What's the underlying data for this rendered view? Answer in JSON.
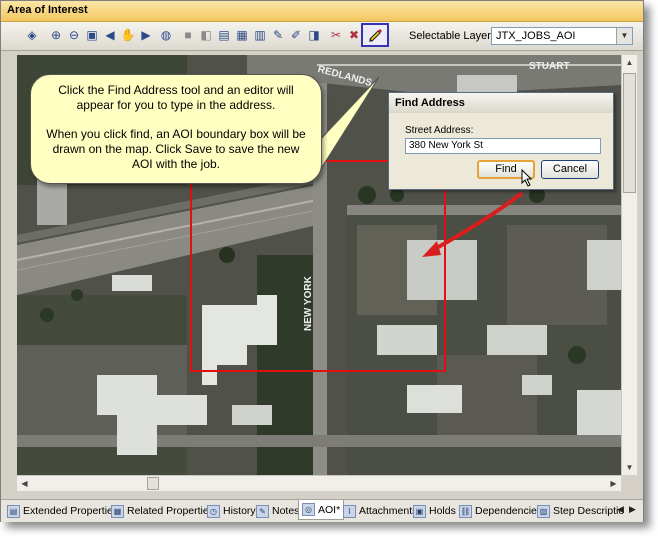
{
  "window": {
    "title": "Area of Interest"
  },
  "toolbar": {
    "icons": [
      "layer-icon",
      "zoom-in-icon",
      "zoom-out-icon",
      "zoom-window-icon",
      "pan-icon",
      "back-icon",
      "forward-icon",
      "globe-icon",
      "select-icon",
      "identify-icon",
      "measure-icon",
      "attribute-icon",
      "chart-icon",
      "edit-icon",
      "sketch-icon",
      "label-icon",
      "clear-icon",
      "erase-icon",
      "find-address-icon"
    ],
    "selectable_layer_label": "Selectable Layer:",
    "selectable_layer_value": "JTX_JOBS_AOI"
  },
  "map": {
    "street_labels": [
      "REDLANDS",
      "STUART",
      "NEW YORK"
    ],
    "aoi_color": "#e01010",
    "arrow_color": "#d81e1e"
  },
  "callout": {
    "line1": "Click the Find Address tool and an editor will appear for you to type in the address.",
    "line2": "When you click find, an AOI boundary box will be drawn on the map.  Click Save to save the new AOI with the job."
  },
  "find_dialog": {
    "title": "Find Address",
    "label": "Street Address:",
    "value": "380 New York St",
    "find_label": "Find",
    "cancel_label": "Cancel"
  },
  "tabs": [
    {
      "label": "Extended Properties",
      "icon": "properties-icon"
    },
    {
      "label": "Related Properties",
      "icon": "related-icon"
    },
    {
      "label": "History",
      "icon": "history-icon"
    },
    {
      "label": "Notes",
      "icon": "notes-icon"
    },
    {
      "label": "AOI*",
      "icon": "aoi-icon",
      "active": true
    },
    {
      "label": "Attachments",
      "icon": "paperclip-icon"
    },
    {
      "label": "Holds",
      "icon": "holds-icon"
    },
    {
      "label": "Dependencies",
      "icon": "dependencies-icon"
    },
    {
      "label": "Step Descriptio",
      "icon": "step-icon"
    }
  ]
}
